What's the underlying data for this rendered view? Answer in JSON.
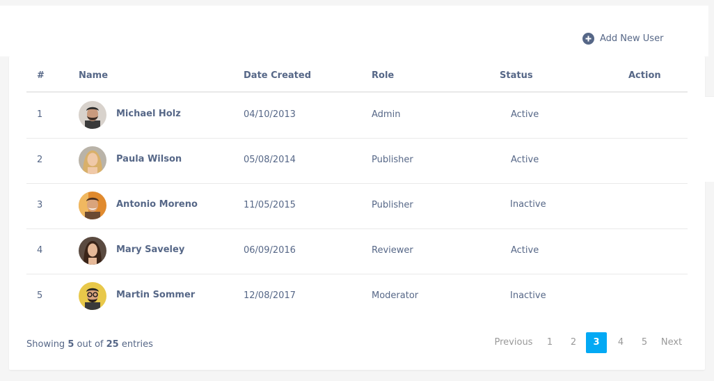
{
  "toolbar": {
    "add_label": "Add New User",
    "add_icon": "plus-circle-icon"
  },
  "table": {
    "headers": [
      "#",
      "Name",
      "Date Created",
      "Role",
      "Status",
      "Action"
    ],
    "rows": [
      {
        "index": "1",
        "name": "Michael Holz",
        "date": "04/10/2013",
        "role": "Admin",
        "status": "Active",
        "avatar": "avatar-man-beard-icon"
      },
      {
        "index": "2",
        "name": "Paula Wilson",
        "date": "05/08/2014",
        "role": "Publisher",
        "status": "Active",
        "avatar": "avatar-woman-blonde-icon"
      },
      {
        "index": "3",
        "name": "Antonio Moreno",
        "date": "11/05/2015",
        "role": "Publisher",
        "status": "Inactive",
        "avatar": "avatar-man-smiling-icon"
      },
      {
        "index": "4",
        "name": "Mary Saveley",
        "date": "06/09/2016",
        "role": "Reviewer",
        "status": "Active",
        "avatar": "avatar-woman-brunette-icon"
      },
      {
        "index": "5",
        "name": "Martin Sommer",
        "date": "12/08/2017",
        "role": "Moderator",
        "status": "Inactive",
        "avatar": "avatar-man-glasses-icon"
      }
    ]
  },
  "footer": {
    "hint_prefix": "Showing",
    "shown": "5",
    "hint_middle": "out of",
    "total": "25",
    "hint_suffix": "entries"
  },
  "pagination": {
    "previous": "Previous",
    "pages": [
      "1",
      "2",
      "3",
      "4",
      "5"
    ],
    "current": "3",
    "next": "Next"
  },
  "colors": {
    "text": "#566787",
    "accent": "#03a9f4",
    "muted": "#999999",
    "divider": "#e9e9e9"
  }
}
